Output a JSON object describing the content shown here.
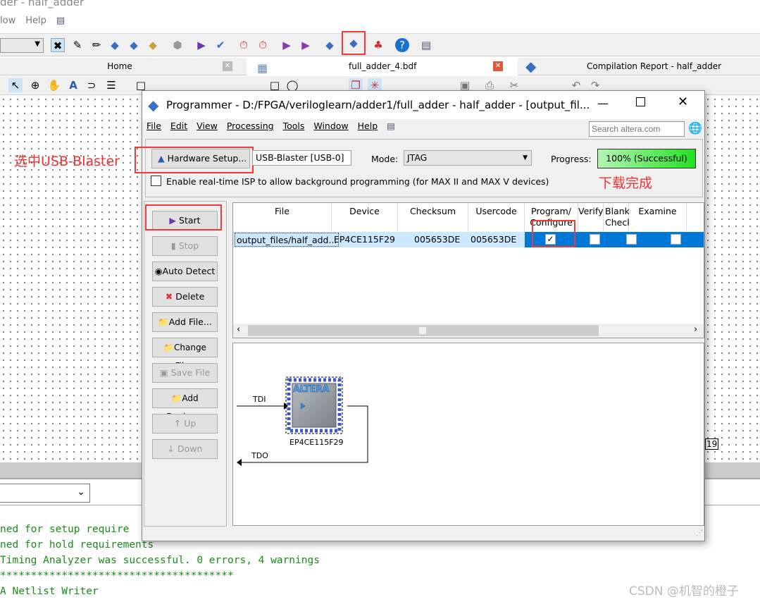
{
  "background_window": {
    "title": "der - half_adder",
    "menu": [
      "low",
      "Help"
    ],
    "tabs": [
      {
        "label": "Home"
      },
      {
        "label": "full_adder_4.bdf"
      },
      {
        "label": "Compilation Report - half_adder"
      }
    ],
    "canvas_label": "19",
    "output_lines": [
      "ned for setup require",
      "ned for hold requirements",
      "Timing Analyzer was successful. 0 errors, 4 warnings",
      "**************************************",
      "A Netlist Writer"
    ]
  },
  "annotations": {
    "select_usb_blaster": "选中USB-Blaster",
    "download_complete": "下载完成",
    "annotation_color": "#f03a3a"
  },
  "programmer": {
    "title": "Programmer - D:/FPGA/veriloglearn/adder1/full_adder - half_adder - [output_fil...",
    "menu": [
      "File",
      "Edit",
      "View",
      "Processing",
      "Tools",
      "Window",
      "Help"
    ],
    "search_placeholder": "Search altera.com",
    "hardware_setup_label": "Hardware Setup...",
    "hardware": "USB-Blaster [USB-0]",
    "mode_label": "Mode:",
    "mode_value": "JTAG",
    "progress_label": "Progress:",
    "progress_text": "100% (Successful)",
    "progress_value": 100,
    "progress_color": "#22e022",
    "isp_checkbox_label": "Enable real-time ISP to allow background programming (for MAX II and MAX V devices)",
    "isp_checked": false,
    "buttons": [
      {
        "label": "Start",
        "enabled": true
      },
      {
        "label": "Stop",
        "enabled": false
      },
      {
        "label": "Auto Detect",
        "enabled": true
      },
      {
        "label": "Delete",
        "enabled": true
      },
      {
        "label": "Add File...",
        "enabled": true
      },
      {
        "label": "Change File..",
        "enabled": true
      },
      {
        "label": "Save File",
        "enabled": false
      },
      {
        "label": "Add Device...",
        "enabled": true
      },
      {
        "label": "Up",
        "enabled": false
      },
      {
        "label": "Down",
        "enabled": false
      }
    ],
    "table": {
      "columns": [
        "File",
        "Device",
        "Checksum",
        "Usercode",
        "Program/ Configure",
        "Verify",
        "Blank- Check",
        "Examine"
      ],
      "rows": [
        {
          "file": "output_files/half_add...",
          "device": "EP4CE115F29",
          "checksum": "005653DE",
          "usercode": "005653DE",
          "program": true,
          "verify": false,
          "blank_check": false,
          "examine": false
        }
      ]
    },
    "chain": {
      "tdi": "TDI",
      "tdo": "TDO",
      "device": "EP4CE115F29",
      "chip_logo": "ALTERA"
    }
  },
  "watermark": "CSDN @机智的橙子"
}
